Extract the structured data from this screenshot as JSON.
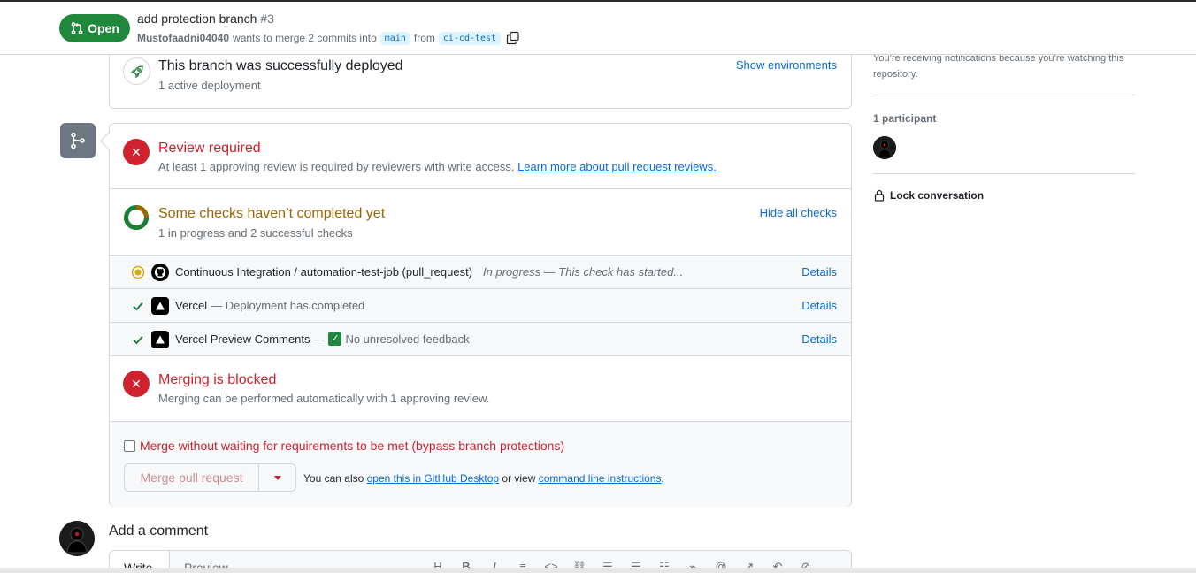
{
  "header": {
    "state": "Open",
    "title": "add protection branch",
    "number": "#3",
    "author": "Mustofaadni04040",
    "merge_text": "wants to merge 2 commits into",
    "base_branch": "main",
    "from_text": "from",
    "head_branch": "ci-cd-test"
  },
  "deployment": {
    "title": "This branch was successfully deployed",
    "subtitle": "1 active deployment",
    "link": "Show environments"
  },
  "review": {
    "title": "Review required",
    "subtitle": "At least 1 approving review is required by reviewers with write access.",
    "link": "Learn more about pull request reviews."
  },
  "checks": {
    "title": "Some checks haven’t completed yet",
    "subtitle": "1 in progress and 2 successful checks",
    "toggle": "Hide all checks",
    "rows": [
      {
        "name": "Continuous Integration / automation-test-job (pull_request)",
        "desc": "In progress — This check has started...",
        "status": "in-progress",
        "details": "Details"
      },
      {
        "name": "Vercel",
        "desc": "— Deployment has completed",
        "status": "success",
        "details": "Details"
      },
      {
        "name": "Vercel Preview Comments",
        "sep": "—",
        "desc": "No unresolved feedback",
        "status": "success",
        "details": "Details"
      }
    ]
  },
  "blocked": {
    "title": "Merging is blocked",
    "subtitle": "Merging can be performed automatically with 1 approving review."
  },
  "merge": {
    "bypass_label": "Merge without waiting for requirements to be met (bypass branch protections)",
    "button": "Merge pull request",
    "alt_prefix": "You can also",
    "alt_link1": "open this in GitHub Desktop",
    "alt_mid": "or view",
    "alt_link2": "command line instructions",
    "alt_suffix": "."
  },
  "comment": {
    "heading": "Add a comment",
    "tab_write": "Write",
    "tab_preview": "Preview",
    "toolbar": [
      "H",
      "B",
      "I",
      "quote",
      "code",
      "link",
      "ordered-list",
      "unordered-list",
      "task-list",
      "attach",
      "mention",
      "reference",
      "reply",
      "slash"
    ]
  },
  "sidebar": {
    "notification": "You’re receiving notifications because you’re watching this repository.",
    "participants_label": "1 participant",
    "lock": "Lock conversation"
  },
  "colors": {
    "open_green": "#1f883d",
    "danger_red": "#cf222e",
    "attention_yellow": "#9a6700",
    "link_blue": "#0969da"
  }
}
